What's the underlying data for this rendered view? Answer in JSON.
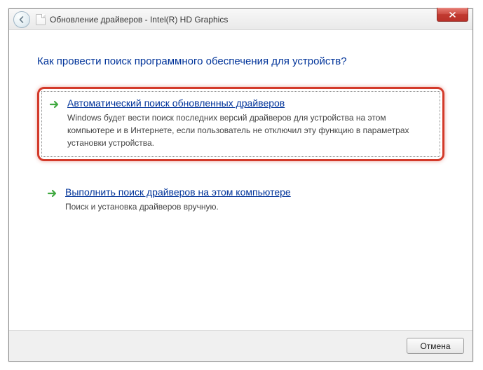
{
  "window": {
    "title": "Обновление драйверов - Intel(R) HD Graphics"
  },
  "heading": "Как провести поиск программного обеспечения для устройств?",
  "options": {
    "auto": {
      "title_pre": "А",
      "title_rest": "втоматический поиск обновленных драйверов",
      "desc": "Windows будет вести поиск последних версий драйверов для устройства на этом компьютере и в Интернете, если пользователь не отключил эту функцию в параметрах установки устройства."
    },
    "manual": {
      "title_pre": "В",
      "title_rest": "ыполнить поиск драйверов на этом компьютере",
      "desc": "Поиск и установка драйверов вручную."
    }
  },
  "footer": {
    "cancel": "Отмена"
  }
}
